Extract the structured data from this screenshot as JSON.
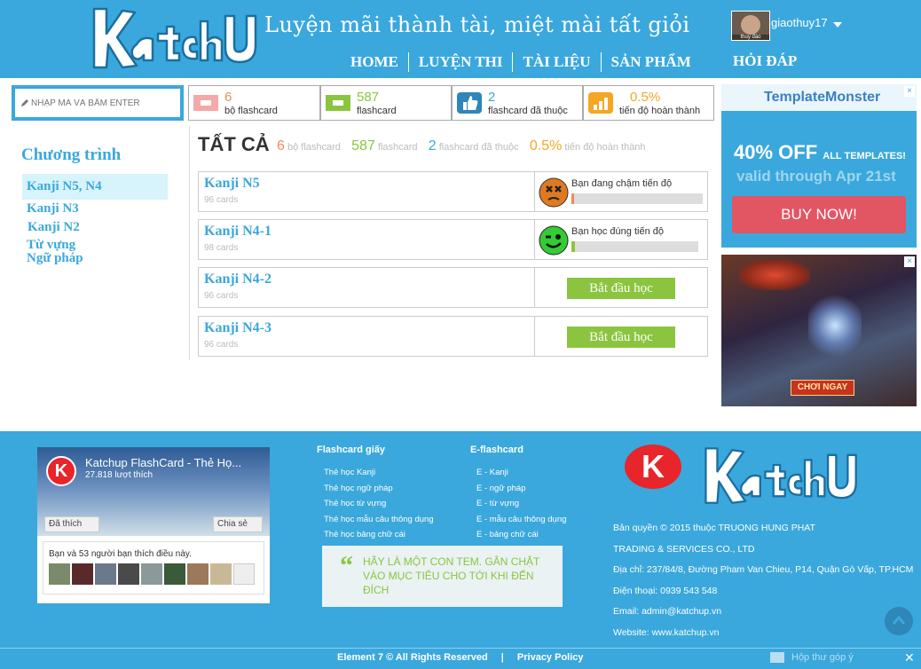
{
  "header": {
    "logo_text": "KatchUp",
    "slogan": "Luyện mãi thành tài, miệt mài tất giỏi",
    "username": "giaothuy17",
    "avatar_caption": "thuy đào",
    "nav": [
      "HOME",
      "LUYỆN THI",
      "TÀI LIỆU",
      "SẢN PHẨM"
    ],
    "nav_extra": "HỎI ĐÁP"
  },
  "search": {
    "placeholder": "NHẬP MÃ VÀ BẤM ENTER"
  },
  "stats": [
    {
      "value": "6",
      "label": "bộ flashcard",
      "color": "#f08c5a",
      "icon": "flashcard-set-icon"
    },
    {
      "value": "587",
      "label": "flashcard",
      "color": "#8bc53f",
      "icon": "flashcard-icon"
    },
    {
      "value": "2",
      "label": "flashcard đã thuộc",
      "color": "#3aa8dc",
      "icon": "thumbs-up-icon"
    },
    {
      "value": "0.5%",
      "label": "tiến độ hoàn thành",
      "color": "#f5a623",
      "icon": "progress-chart-icon"
    }
  ],
  "sidebar": {
    "title": "Chương trình",
    "items": [
      {
        "label": "Kanji N5, N4"
      },
      {
        "label": "Kanji N3"
      },
      {
        "label": "Kanji N2"
      },
      {
        "label": "Từ  vựng"
      },
      {
        "label": "Ngữ pháp"
      }
    ]
  },
  "main": {
    "title": "TẤT CẢ",
    "summary": [
      {
        "value": "6",
        "label": "bộ flashcard",
        "color": "#f08c5a"
      },
      {
        "value": "587",
        "label": "flashcard",
        "color": "#8bc53f"
      },
      {
        "value": "2",
        "label": "flashcard đã thuộc",
        "color": "#3aa8dc"
      },
      {
        "value": "0.5%",
        "label": "tiến độ hoàn thành",
        "color": "#f5a623"
      }
    ],
    "cards": [
      {
        "name": "Kanji N5",
        "count": "96 cards",
        "status": "Bạn đang chậm tiến độ",
        "progress_fraction": 0.02,
        "progress_color": "#f08c5a",
        "icon": "sad-face-icon"
      },
      {
        "name": "Kanji N4-1",
        "count": "98 cards",
        "status": "Bạn học đúng tiến độ",
        "progress_fraction": 0.03,
        "progress_color": "#8bc53f",
        "icon": "wink-face-icon"
      },
      {
        "name": "Kanji N4-2",
        "count": "96 cards",
        "button": "Bắt đầu học"
      },
      {
        "name": "Kanji N4-3",
        "count": "96 cards",
        "button": "Bắt đầu học"
      }
    ]
  },
  "ads": {
    "templatemonster": {
      "brand": "TemplateMonster",
      "offer": "40% OFF",
      "offer_small": "ALL TEMPLATES!",
      "valid": "valid through Apr 21st",
      "button": "BUY NOW!"
    },
    "game": {
      "button": "CHƠI NGAY"
    }
  },
  "footer": {
    "fb": {
      "page_name": "Katchup FlashCard - Thẻ Họ...",
      "likes": "27.818 lượt thích",
      "like_btn": "Đã thích",
      "share_btn": "Chia sẻ",
      "friends_text": "Bạn và 53 người bạn thích điều này."
    },
    "col1": {
      "title": "Flashcard giấy",
      "links": [
        "Thẻ học Kanji",
        "Thẻ học ngữ pháp",
        "Thẻ học từ vựng",
        "Thẻ học mẫu câu thông dụng",
        "Thẻ học bảng chữ cái"
      ]
    },
    "col2": {
      "title": "E-flashcard",
      "links": [
        "E - Kanji",
        "E - ngữ pháp",
        "E - từ vựng",
        "E - mẫu câu thông dụng",
        "E - bảng chữ cái"
      ]
    },
    "quote": "HÃY LÀ MỘT CON TEM. GẮN CHẶT VÀO MỤC TIÊU CHO TỚI KHI ĐẾN ĐÍCH",
    "logo_letter": "K",
    "info": [
      "Bản quyền © 2015 thuộc TRUONG HUNG PHAT",
      "TRADING & SERVICES CO., LTD",
      "Địa chỉ: 237/84/8, Đường Pham Van Chieu, P14, Quận Gò Vấp, TP.HCM",
      "Điện thoại: 0939 543 548",
      "Email: admin@katchup.vn",
      "Website: www.katchup.vn"
    ],
    "bottom_left": "Element 7 © All Rights Reserved",
    "bottom_sep": "|",
    "bottom_right": "Privacy Policy",
    "feedback": "Hộp thư góp ý"
  }
}
